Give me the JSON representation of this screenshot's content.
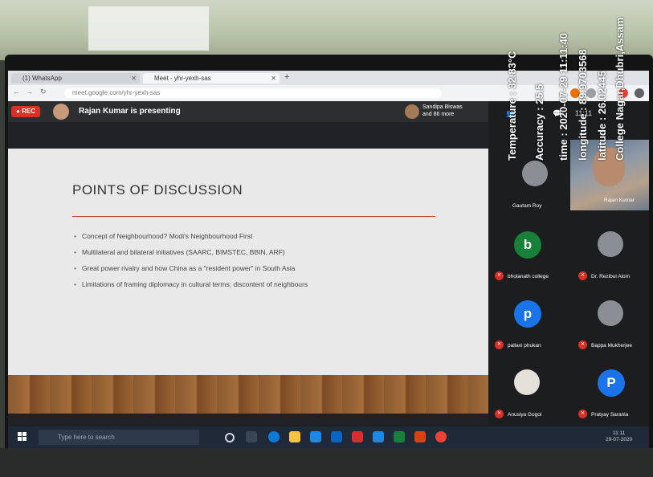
{
  "browser": {
    "tabs": [
      {
        "label": "(1) WhatsApp"
      },
      {
        "label": "Meet - yhr-yexh-sas"
      }
    ],
    "url": "meet.google.com/yhr-yexh-sas"
  },
  "meet": {
    "rec_label": "REC",
    "presenter_text": "Rajan Kumar is presenting",
    "others_text": "Sandipa Biswas and 86 more",
    "clock": "11:11"
  },
  "slide": {
    "title": "POINTS OF DISCUSSION",
    "bullets": [
      "Concept of Neighbourhood? Modi's Neighbourhood First",
      "Multilateral and bilateral initiatives (SAARC, BIMSTEC, BBIN, ARF)",
      "Great power rivalry and how China as a \"resident power\" in South Asia",
      "Limitations of framing diplomacy in cultural terms; discontent of neighbours"
    ]
  },
  "participants": {
    "self_name": "Rajan Kumar",
    "tiles": [
      {
        "name": "Gautam Roy",
        "initial": "",
        "color": ""
      },
      {
        "name": "bholanath college",
        "initial": "b",
        "color": "#188038"
      },
      {
        "name": "Dr. Rezibul Alom",
        "initial": "",
        "color": ""
      },
      {
        "name": "pallavi phukan",
        "initial": "p",
        "color": "#1a73e8"
      },
      {
        "name": "Bappa Mukherjee",
        "initial": "",
        "color": ""
      },
      {
        "name": "Anusiya Gogoi",
        "initial": "",
        "color": ""
      },
      {
        "name": "Pratyay Sarania",
        "initial": "P",
        "color": "#1a73e8"
      }
    ]
  },
  "taskbar": {
    "search_placeholder": "Type here to search",
    "time": "11:11",
    "date": "29-07-2020"
  },
  "gps_overlay": {
    "temperature": "Temperature : 32.83°C",
    "accuracy": "Accuracy : 25.5",
    "datetime": "time : 2020-07-29 11:11:40",
    "longitude": "longitude : 89.9703568",
    "latitude": "latitude : 26.02445",
    "place": "College Nagar,Dhubri,Assam"
  }
}
